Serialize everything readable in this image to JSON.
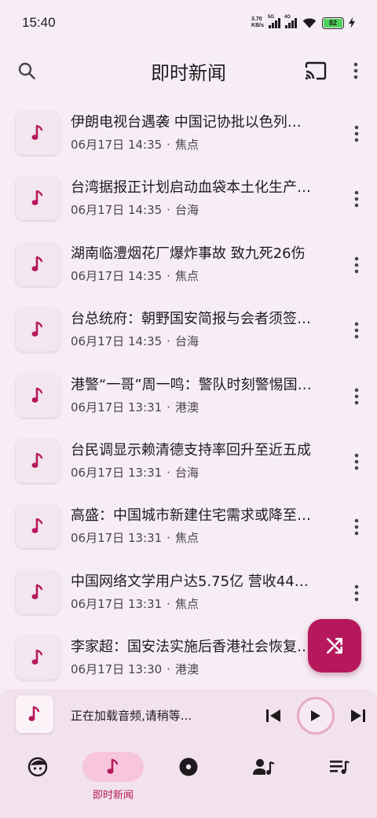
{
  "status_bar": {
    "time": "15:40",
    "net_speed_value": "3.70",
    "net_speed_unit": "KB/s",
    "signal1_tag": "5G",
    "signal2_tag": "4G",
    "battery": "82"
  },
  "app_bar": {
    "title": "即时新闻",
    "icons": {
      "search": "search-icon",
      "cast": "cast-icon",
      "menu": "more-vert-icon"
    }
  },
  "news": [
    {
      "title": "伊朗电视台遇袭 中国记协批以色列…",
      "time": "06月17日 14:35",
      "category": "焦点"
    },
    {
      "title": "台湾据报正计划启动血袋本土化生产…",
      "time": "06月17日 14:35",
      "category": "台海"
    },
    {
      "title": "湖南临澧烟花厂爆炸事故 致九死26伤",
      "time": "06月17日 14:35",
      "category": "焦点"
    },
    {
      "title": "台总统府：朝野国安简报与会者须签…",
      "time": "06月17日 14:35",
      "category": "台海"
    },
    {
      "title": "港警“一哥”周一鸣：警队时刻警惕国…",
      "time": "06月17日 13:31",
      "category": "港澳"
    },
    {
      "title": "台民调显示赖清德支持率回升至近五成",
      "time": "06月17日 13:31",
      "category": "台海"
    },
    {
      "title": "高盛：中国城市新建住宅需求或降至…",
      "time": "06月17日 13:31",
      "category": "焦点"
    },
    {
      "title": "中国网络文学用户达5.75亿 营收44…",
      "time": "06月17日 13:31",
      "category": "焦点"
    },
    {
      "title": "李家超：国安法实施后香港社会恢复…",
      "time": "06月17日 13:30",
      "category": "港澳"
    }
  ],
  "meta_separator": "·",
  "player": {
    "status": "正在加载音频,请稍等...",
    "icons": {
      "prev": "skip-previous-icon",
      "play": "play-icon",
      "next": "skip-next-icon"
    }
  },
  "fab": {
    "icon": "shuffle-icon"
  },
  "bottom_nav": [
    {
      "icon": "face-icon",
      "label": "",
      "active": false
    },
    {
      "icon": "music-note-icon",
      "label": "即时新闻",
      "active": true
    },
    {
      "icon": "album-icon",
      "label": "",
      "active": false
    },
    {
      "icon": "artist-icon",
      "label": "",
      "active": false
    },
    {
      "icon": "playlist-icon",
      "label": "",
      "active": false
    }
  ],
  "colors": {
    "accent": "#b5195c",
    "background": "#f7eef5",
    "player_bg": "#f2e2ec",
    "active_pill": "#f7c6dc",
    "battery": "#4bd35a"
  }
}
